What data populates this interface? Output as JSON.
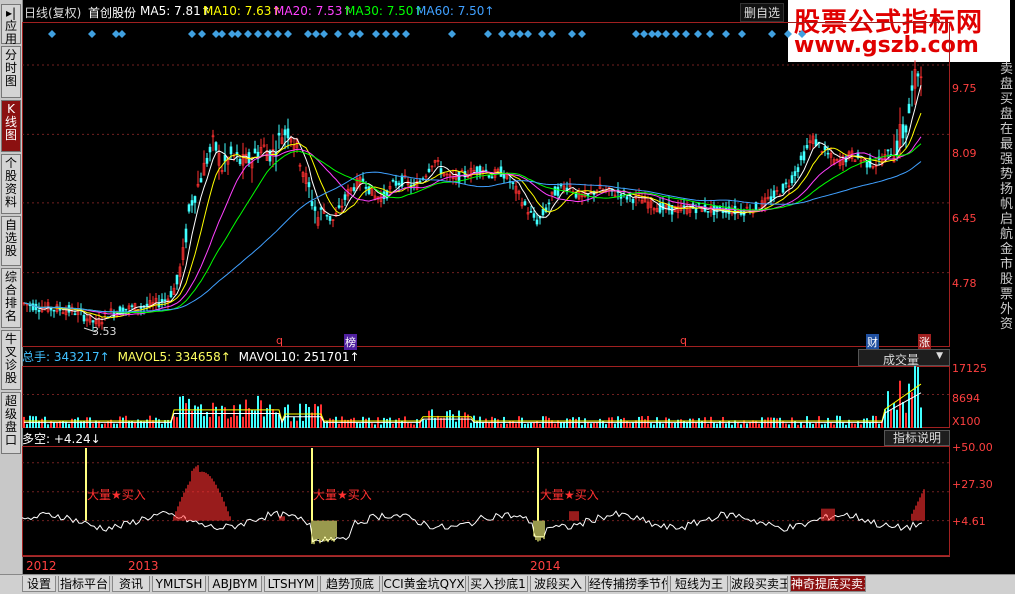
{
  "sidebar": {
    "tabs": [
      {
        "label": "▸|应用"
      },
      {
        "label": "分时图"
      },
      {
        "label": "K线图"
      },
      {
        "label": "个股资料"
      },
      {
        "label": "自选股"
      },
      {
        "label": "综合排名"
      },
      {
        "label": "牛叉诊股"
      },
      {
        "label": "超级盘口"
      }
    ]
  },
  "header": {
    "chart_type": "日线(复权)",
    "stock_name": "首创股份",
    "ma5": "MA5: 7.81↑",
    "ma10": "MA10: 7.63↑",
    "ma20": "MA20: 7.53↑",
    "ma30": "MA30: 7.50↑",
    "ma60": "MA60: 7.50↑",
    "delete_watch": "删自选"
  },
  "colors": {
    "ma5": "#ffffff",
    "ma10": "#ffff00",
    "ma20": "#ff40ff",
    "ma30": "#00ff00",
    "ma60": "#40a0ff",
    "up": "#ff3030",
    "down": "#40ffff",
    "signal": "#ffff80"
  },
  "watermark": {
    "line1": "股票公式指标网",
    "line2": "www.gszb.com"
  },
  "price_pane": {
    "y_ticks": [
      "9.75",
      "8.09",
      "6.45",
      "4.78"
    ],
    "low_label": "3.53",
    "markers": [
      "q",
      "榜",
      "q",
      "财",
      "涨"
    ]
  },
  "volume_pane": {
    "total_hands": "总手: 343217↑",
    "mavol5": "MAVOL5: 334658↑",
    "mavol10": "MAVOL10: 251701↑",
    "dropdown": "成交量",
    "y_ticks": [
      "17125",
      "8694",
      "X100"
    ]
  },
  "indicator_pane": {
    "title": "多空: +4.24↓",
    "explain_button": "指标说明",
    "signal_text": "大量★买入",
    "y_ticks": [
      "+50.00",
      "+27.30",
      "+4.61"
    ]
  },
  "time_axis": [
    "2012",
    "2013",
    "2014"
  ],
  "right_panel": {
    "text": "卖盘 买盘 在最强势扬帆启航金市股票外资"
  },
  "bottom_tabs": [
    "设置",
    "指标平台",
    "资讯",
    "YMLTSH",
    "ABJBYM",
    "LTSHYM",
    "趋势顶底",
    "CCI黄金坑QYX",
    "买入抄底1",
    "波段买入",
    "经传捕捞季节付",
    "短线为王",
    "波段买卖王",
    "神奇提底买卖王指"
  ],
  "chart_data": {
    "type": "candlestick",
    "price_ylim": [
      3.0,
      10.3
    ],
    "price_ticks": [
      9.75,
      8.09,
      6.45,
      4.78
    ],
    "price_path": [
      [
        0,
        4.05
      ],
      [
        20,
        3.95
      ],
      [
        40,
        3.9
      ],
      [
        55,
        3.85
      ],
      [
        65,
        3.7
      ],
      [
        75,
        3.55
      ],
      [
        85,
        3.8
      ],
      [
        100,
        3.9
      ],
      [
        115,
        3.95
      ],
      [
        130,
        4.0
      ],
      [
        145,
        4.15
      ],
      [
        155,
        4.5
      ],
      [
        162,
        5.3
      ],
      [
        168,
        6.4
      ],
      [
        175,
        6.8
      ],
      [
        185,
        7.5
      ],
      [
        192,
        7.9
      ],
      [
        200,
        7.3
      ],
      [
        210,
        7.6
      ],
      [
        220,
        7.4
      ],
      [
        230,
        7.5
      ],
      [
        240,
        7.8
      ],
      [
        250,
        7.6
      ],
      [
        260,
        8.1
      ],
      [
        268,
        8.2
      ],
      [
        276,
        7.7
      ],
      [
        284,
        7.0
      ],
      [
        290,
        6.5
      ],
      [
        296,
        6.1
      ],
      [
        302,
        6.3
      ],
      [
        310,
        6.0
      ],
      [
        318,
        6.3
      ],
      [
        326,
        6.7
      ],
      [
        334,
        6.9
      ],
      [
        342,
        7.0
      ],
      [
        352,
        6.6
      ],
      [
        362,
        6.6
      ],
      [
        372,
        6.9
      ],
      [
        382,
        7.0
      ],
      [
        392,
        6.8
      ],
      [
        402,
        7.1
      ],
      [
        412,
        7.5
      ],
      [
        420,
        7.2
      ],
      [
        430,
        7.0
      ],
      [
        440,
        7.1
      ],
      [
        450,
        7.2
      ],
      [
        460,
        7.3
      ],
      [
        470,
        7.1
      ],
      [
        480,
        7.2
      ],
      [
        490,
        6.9
      ],
      [
        500,
        6.5
      ],
      [
        508,
        6.2
      ],
      [
        516,
        6.0
      ],
      [
        524,
        6.3
      ],
      [
        532,
        6.7
      ],
      [
        540,
        6.8
      ],
      [
        548,
        6.9
      ],
      [
        556,
        6.6
      ],
      [
        566,
        6.6
      ],
      [
        576,
        6.8
      ],
      [
        586,
        6.7
      ],
      [
        596,
        6.7
      ],
      [
        606,
        6.6
      ],
      [
        616,
        6.55
      ],
      [
        626,
        6.45
      ],
      [
        636,
        6.35
      ],
      [
        646,
        6.3
      ],
      [
        656,
        6.3
      ],
      [
        666,
        6.3
      ],
      [
        676,
        6.35
      ],
      [
        686,
        6.3
      ],
      [
        696,
        6.25
      ],
      [
        706,
        6.3
      ],
      [
        716,
        6.25
      ],
      [
        726,
        6.3
      ],
      [
        736,
        6.35
      ],
      [
        746,
        6.5
      ],
      [
        756,
        6.7
      ],
      [
        766,
        6.9
      ],
      [
        776,
        7.3
      ],
      [
        784,
        7.7
      ],
      [
        790,
        8.0
      ],
      [
        798,
        7.8
      ],
      [
        806,
        7.6
      ],
      [
        814,
        7.4
      ],
      [
        822,
        7.5
      ],
      [
        830,
        7.6
      ],
      [
        838,
        7.5
      ],
      [
        846,
        7.4
      ],
      [
        856,
        7.4
      ],
      [
        866,
        7.6
      ],
      [
        876,
        7.9
      ],
      [
        884,
        8.3
      ],
      [
        890,
        9.0
      ],
      [
        896,
        9.6
      ],
      [
        900,
        9.9
      ]
    ],
    "volume_ylim": [
      0,
      20000
    ],
    "indicator_ylim": [
      -20,
      60
    ],
    "indicator_ticks": [
      50.0,
      27.3,
      4.61
    ]
  }
}
